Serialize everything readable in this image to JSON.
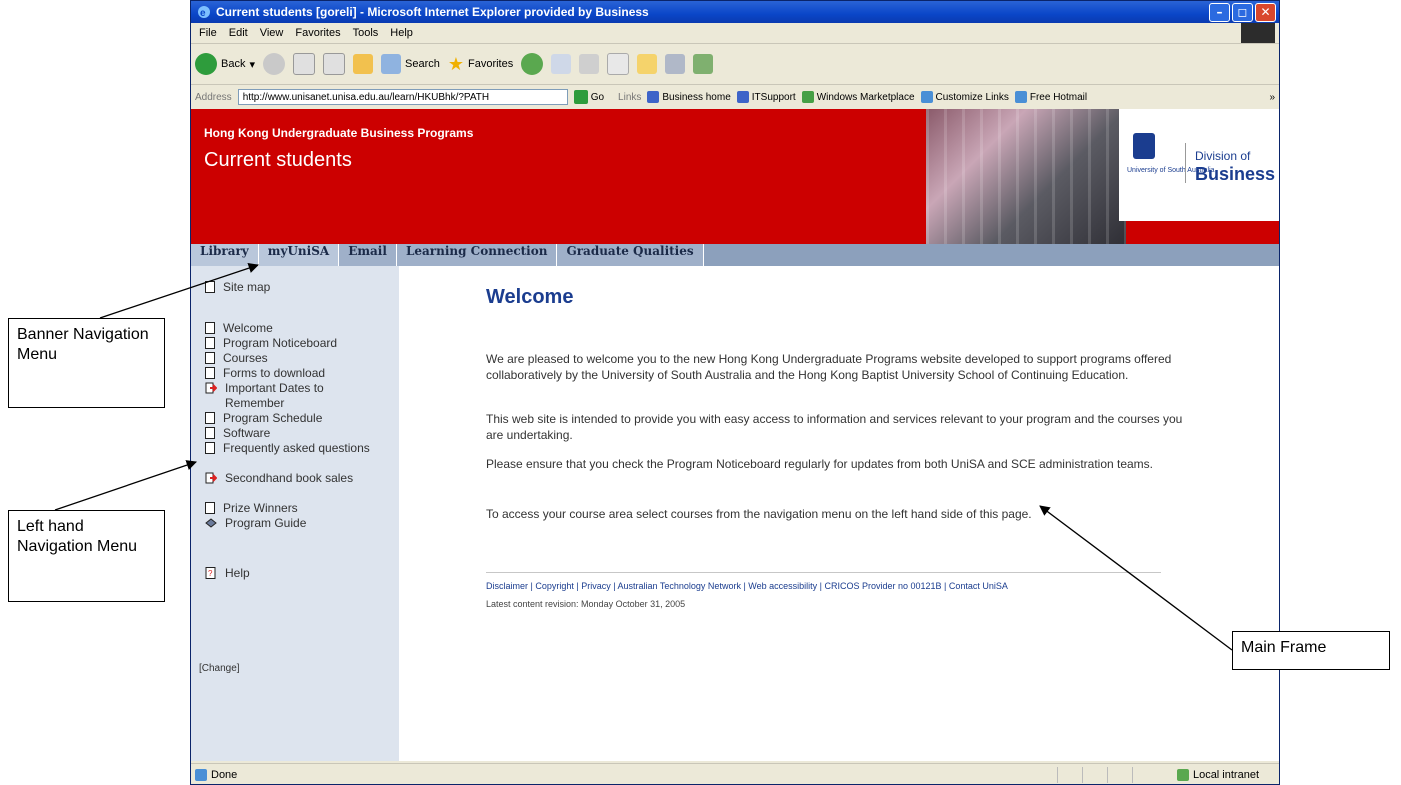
{
  "window": {
    "title": "Current students [goreli] - Microsoft Internet Explorer provided by Business",
    "minimize": "–",
    "maximize": "◻",
    "close": "✕"
  },
  "menu": [
    "File",
    "Edit",
    "View",
    "Favorites",
    "Tools",
    "Help"
  ],
  "toolbar": {
    "back": "Back",
    "search": "Search",
    "favorites": "Favorites"
  },
  "address": {
    "label": "Address",
    "url": "http://www.unisanet.unisa.edu.au/learn/HKUBhk/?PATH",
    "go": "Go",
    "links_label": "Links",
    "links": [
      "Business home",
      "ITSupport",
      "Windows Marketplace",
      "Customize Links",
      "Free Hotmail"
    ],
    "chevron": "»"
  },
  "banner": {
    "program": "Hong Kong Undergraduate Business Programs",
    "section": "Current students",
    "university": "University of South Australia",
    "division": "Division of",
    "business": "Business"
  },
  "nav": [
    "Library",
    "myUniSA",
    "Email",
    "Learning Connection",
    "Graduate Qualities"
  ],
  "sidebar": {
    "items": [
      {
        "label": "Site map",
        "icon": "page-icon"
      },
      {
        "label": "Welcome",
        "icon": "page-icon"
      },
      {
        "label": "Program Noticeboard",
        "icon": "page-icon"
      },
      {
        "label": "Courses",
        "icon": "page-icon"
      },
      {
        "label": "Forms to download",
        "icon": "page-icon"
      },
      {
        "label": "Important Dates to Remember",
        "icon": "external-link-icon"
      },
      {
        "label": "Program Schedule",
        "icon": "page-icon"
      },
      {
        "label": "Software",
        "icon": "page-icon"
      },
      {
        "label": "Frequently asked questions",
        "icon": "page-icon"
      },
      {
        "label": "Secondhand book sales",
        "icon": "external-link-icon"
      },
      {
        "label": "Prize Winners",
        "icon": "page-icon"
      },
      {
        "label": "Program Guide",
        "icon": "book-icon"
      },
      {
        "label": "Help",
        "icon": "help-icon"
      }
    ],
    "change": "[Change]"
  },
  "main": {
    "heading": "Welcome",
    "paragraphs": [
      "We are pleased to welcome you to the new Hong Kong Undergraduate Programs website developed to support programs offered collaboratively by the University of South Australia and the Hong Kong Baptist University School of Continuing Education.",
      "This web site is intended to provide you with easy access to information and services relevant to your program and the courses you are undertaking.",
      "Please ensure that you check the Program Noticeboard regularly for updates from both UniSA and SCE administration teams.",
      "To access your course area select courses from the navigation menu on the left hand side of this page."
    ],
    "footer": "Disclaimer | Copyright | Privacy | Australian Technology Network | Web accessibility | CRICOS Provider no 00121B | Contact UniSA",
    "revision": "Latest content revision: Monday October 31, 2005"
  },
  "status": {
    "left": "Done",
    "zone": "Local intranet"
  },
  "annotations": {
    "banner": "Banner Navigation Menu",
    "left": "Left hand Navigation Menu",
    "main": "Main Frame"
  }
}
